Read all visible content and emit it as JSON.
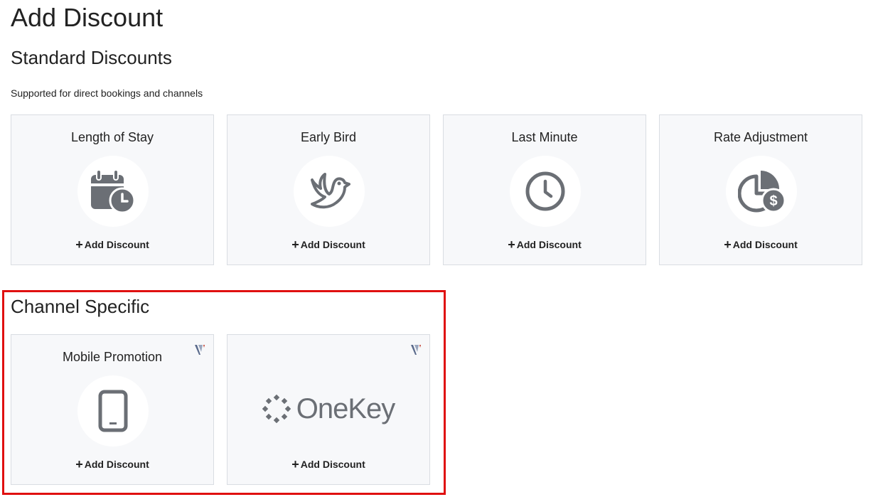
{
  "page": {
    "title": "Add Discount"
  },
  "standard": {
    "title": "Standard Discounts",
    "subtitle": "Supported for direct bookings and channels",
    "cards": [
      {
        "title": "Length of Stay",
        "icon": "calendar-clock-icon",
        "action": "Add Discount"
      },
      {
        "title": "Early Bird",
        "icon": "bird-icon",
        "action": "Add Discount"
      },
      {
        "title": "Last Minute",
        "icon": "clock-icon",
        "action": "Add Discount"
      },
      {
        "title": "Rate Adjustment",
        "icon": "pie-chart-dollar-icon",
        "action": "Add Discount"
      }
    ]
  },
  "channel": {
    "title": "Channel Specific",
    "cards": [
      {
        "title": "Mobile Promotion",
        "icon": "mobile-phone-icon",
        "action": "Add Discount"
      },
      {
        "logo_text": "OneKey",
        "icon": "onekey-logo",
        "action": "Add Discount"
      }
    ]
  },
  "colors": {
    "icon": "#6b6f75",
    "card_bg": "#f7f8fa",
    "highlight": "#e01010"
  }
}
